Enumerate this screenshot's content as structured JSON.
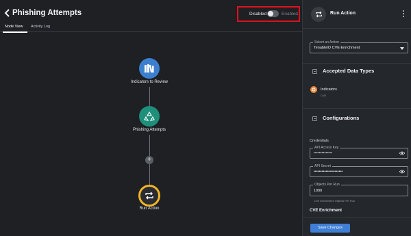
{
  "header": {
    "title": "Phishing Attempts",
    "toggle": {
      "disabled_label": "Disabled",
      "enabled_label": "Enabled",
      "state": "disabled"
    }
  },
  "tabs": [
    {
      "label": "Node View",
      "active": true
    },
    {
      "label": "Activity Log",
      "active": false
    }
  ],
  "flow": {
    "nodes": [
      {
        "label": "Indicators to Review",
        "icon": "books-icon",
        "color": "#3d7fcf"
      },
      {
        "label": "Phishing Attempts",
        "icon": "recycle-icon",
        "color": "#1d8f7a"
      },
      {
        "label": "Run Action",
        "icon": "repeat-icon",
        "color": "#f0b429"
      }
    ],
    "add_label": "+"
  },
  "panel": {
    "title": "Run Action",
    "select_action": {
      "label": "Select an Action",
      "value": "TenableIO CVE Enrichment"
    },
    "accepted_data_types": {
      "title": "Accepted Data Types",
      "items": [
        {
          "name": "Indicators",
          "sub": "CVE",
          "color": "#e88b3a"
        }
      ]
    },
    "configurations": {
      "title": "Configurations",
      "credentials_label": "Credentials",
      "api_access_key": {
        "label": "API Access Key",
        "value": "••••••••••••••"
      },
      "api_secret": {
        "label": "API Secret",
        "value": "••••••••••••••••••••••"
      },
      "objects_per_run": {
        "label": "Objects Per Run",
        "value": "1000",
        "helper": "CVE Enrichment Objects Per Run"
      },
      "cve_section_title": "CVE Enrichment"
    },
    "save_label": "Save Changes"
  }
}
